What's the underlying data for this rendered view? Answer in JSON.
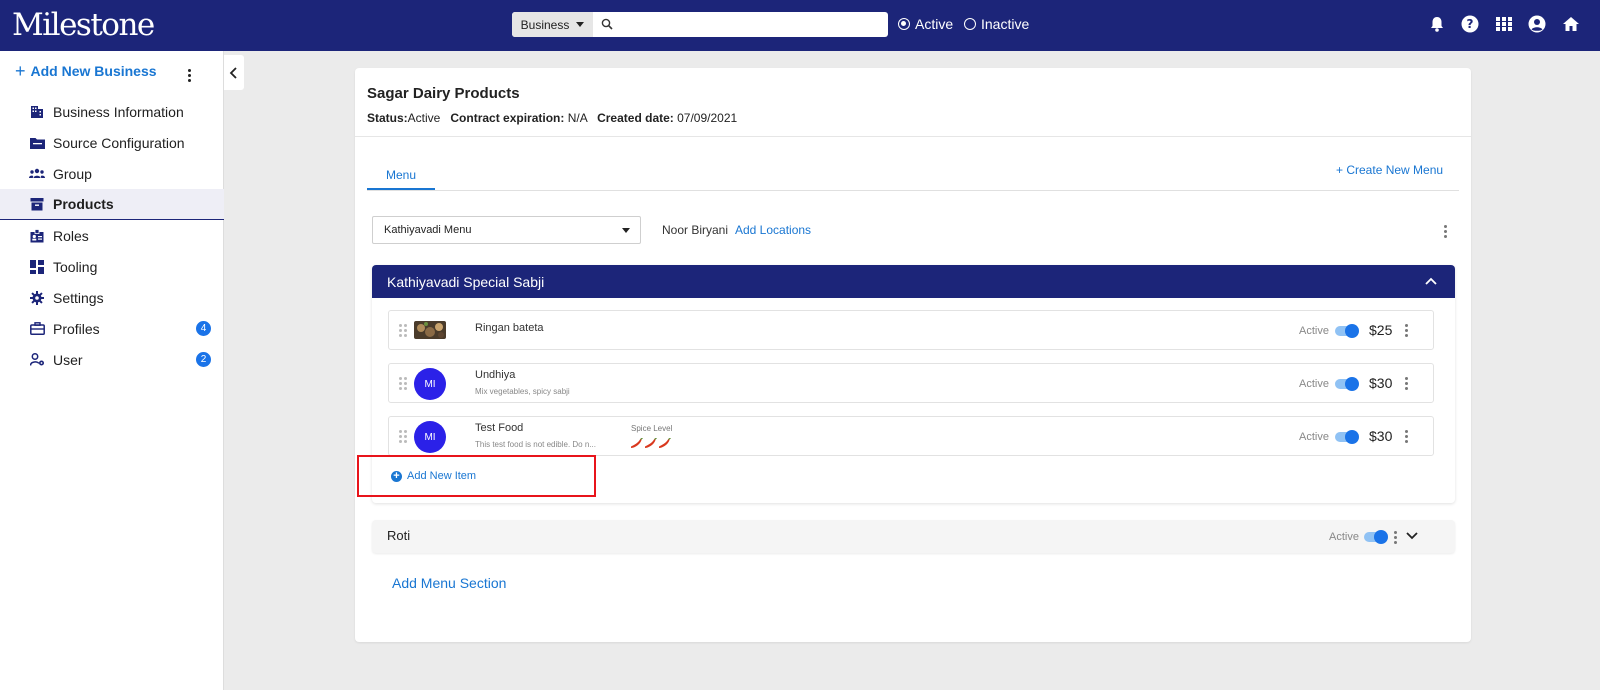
{
  "app": {
    "logo": "Milestone"
  },
  "topbar": {
    "business_select": "Business",
    "search_placeholder": "",
    "radio_active": "Active",
    "radio_inactive": "Inactive",
    "icons": [
      "bell-icon",
      "help-icon",
      "apps-grid-icon",
      "account-icon",
      "home-icon"
    ]
  },
  "sidebar": {
    "add_label": "Add New Business",
    "items": [
      {
        "label": "Business Information",
        "icon": "building-icon"
      },
      {
        "label": "Source Configuration",
        "icon": "folder-icon"
      },
      {
        "label": "Group",
        "icon": "group-icon"
      },
      {
        "label": "Products",
        "icon": "archive-icon",
        "active": true
      },
      {
        "label": "Roles",
        "icon": "badge-icon"
      },
      {
        "label": "Tooling",
        "icon": "dashboard-icon"
      },
      {
        "label": "Settings",
        "icon": "gear-icon"
      },
      {
        "label": "Profiles",
        "icon": "briefcase-icon",
        "badge": "4"
      },
      {
        "label": "User",
        "icon": "user-settings-icon",
        "badge": "2"
      }
    ]
  },
  "business": {
    "name": "Sagar Dairy Products",
    "status_label": "Status:",
    "status_value": "Active",
    "contract_label": "Contract expiration:",
    "contract_value": "N/A",
    "created_label": "Created date:",
    "created_value": "07/09/2021"
  },
  "tabs": {
    "menu": "Menu",
    "create_menu": "Create New Menu"
  },
  "menu_bar": {
    "selected_menu": "Kathiyavadi Menu",
    "location": "Noor Biryani",
    "add_locations": "Add Locations"
  },
  "section": {
    "title": "Kathiyavadi Special Sabji",
    "items": [
      {
        "name": "Ringan bateta",
        "description": "",
        "status": "Active",
        "price": "$25",
        "avatar": ""
      },
      {
        "name": "Undhiya",
        "description": "Mix vegetables, spicy sabji",
        "status": "Active",
        "price": "$30",
        "avatar": "MI"
      },
      {
        "name": "Test Food",
        "description": "This test food is not edible. Do n...",
        "spice_label": "Spice Level",
        "spice_level": 3,
        "status": "Active",
        "price": "$30",
        "avatar": "MI"
      }
    ],
    "add_item": "Add New Item"
  },
  "section2": {
    "title": "Roti",
    "status": "Active"
  },
  "add_menu_section": "Add Menu Section",
  "colors": {
    "primary": "#1c2579",
    "accent": "#1976d2",
    "highlight": "#e8141b"
  }
}
